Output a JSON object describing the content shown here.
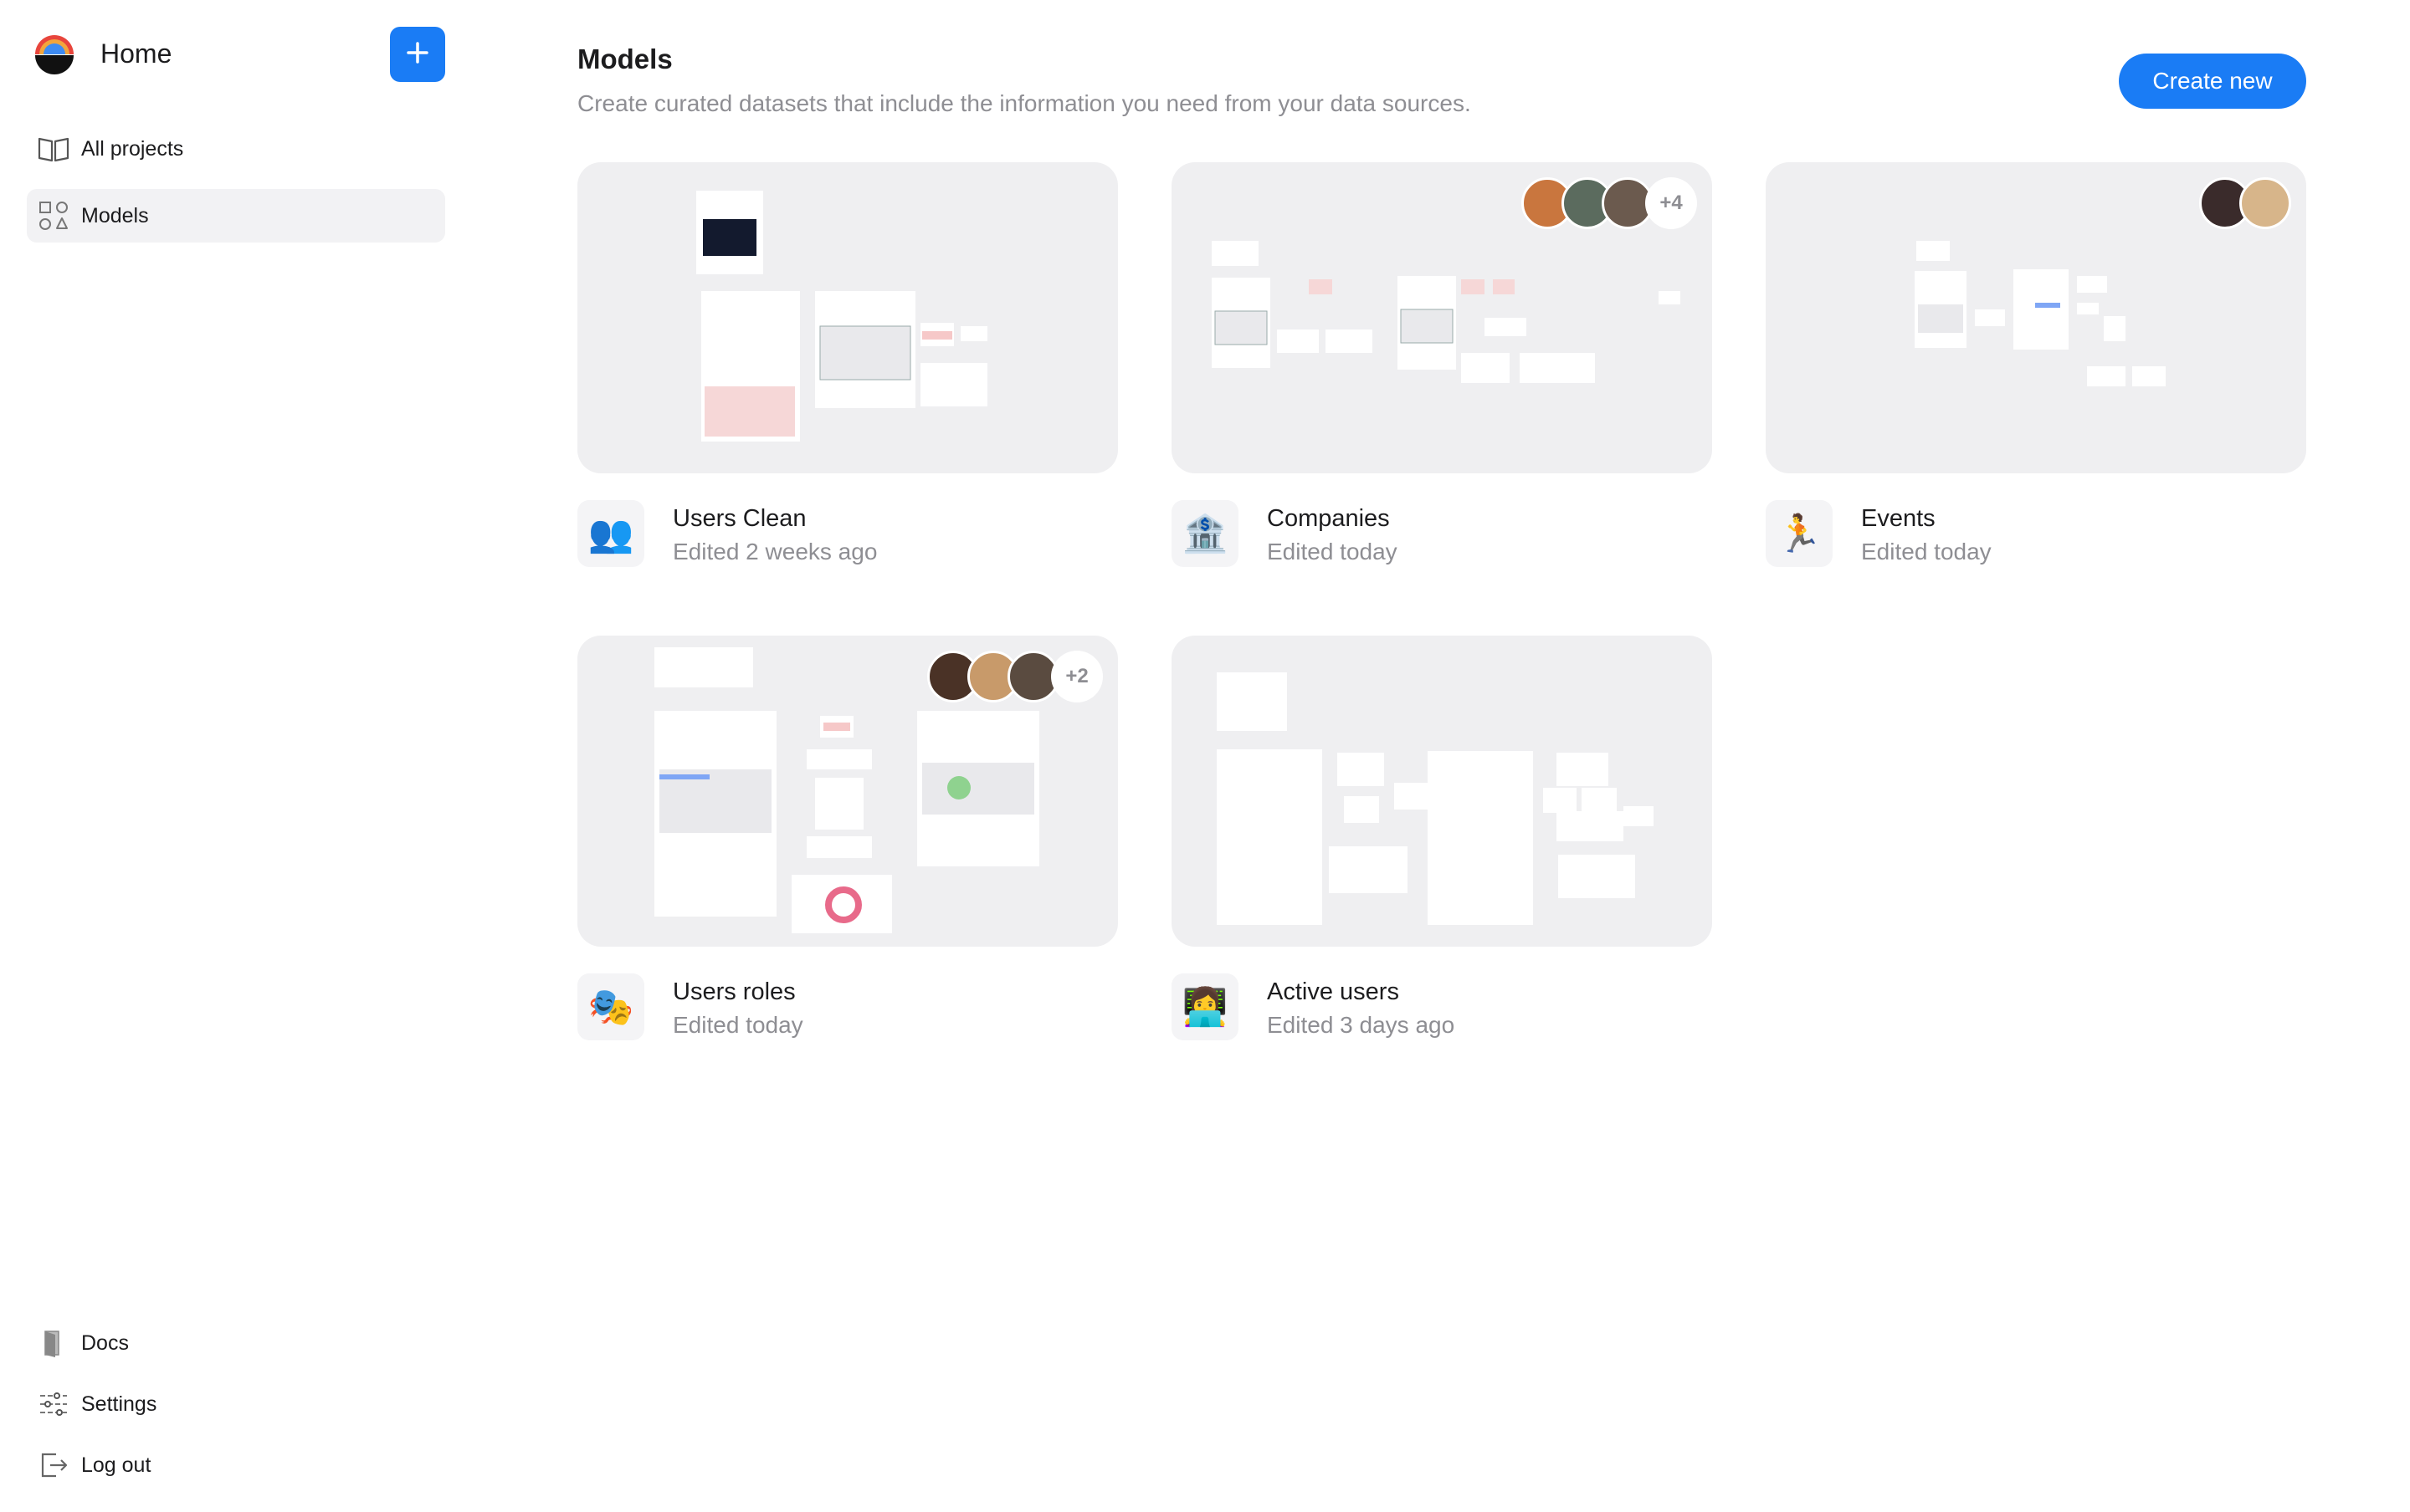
{
  "sidebar": {
    "title": "Home",
    "add_button_icon": "plus-icon",
    "nav_top": [
      {
        "label": "All projects",
        "icon": "book-icon"
      },
      {
        "label": "Models",
        "icon": "shapes-icon",
        "active": true
      }
    ],
    "nav_bottom": [
      {
        "label": "Docs",
        "icon": "door-icon"
      },
      {
        "label": "Settings",
        "icon": "sliders-icon"
      },
      {
        "label": "Log out",
        "icon": "logout-icon"
      }
    ]
  },
  "main": {
    "title": "Models",
    "subtitle": "Create curated datasets that include the information you need from your data sources.",
    "create_button": "Create new",
    "cards": [
      {
        "name": "Users Clean",
        "edited": "Edited 2 weeks ago",
        "emoji": "👥",
        "avatars": [],
        "more": ""
      },
      {
        "name": "Companies",
        "edited": "Edited today",
        "emoji": "🏦",
        "avatars": [
          "#c9763e",
          "#5b6b5e",
          "#6b5a4e"
        ],
        "more": "+4"
      },
      {
        "name": "Events",
        "edited": "Edited today",
        "emoji": "🏃",
        "avatars": [
          "#3a2b2b",
          "#d7b58a"
        ],
        "more": ""
      },
      {
        "name": "Users roles",
        "edited": "Edited today",
        "emoji": "🎭",
        "avatars": [
          "#4a3226",
          "#c89a6a",
          "#5a4b40"
        ],
        "more": "+2"
      },
      {
        "name": "Active users",
        "edited": "Edited 3 days ago",
        "emoji": "👩‍💻",
        "avatars": [],
        "more": ""
      }
    ]
  },
  "colors": {
    "accent": "#1a7cf5",
    "muted_text": "#8e8e93",
    "thumb_bg": "#efeff1"
  }
}
